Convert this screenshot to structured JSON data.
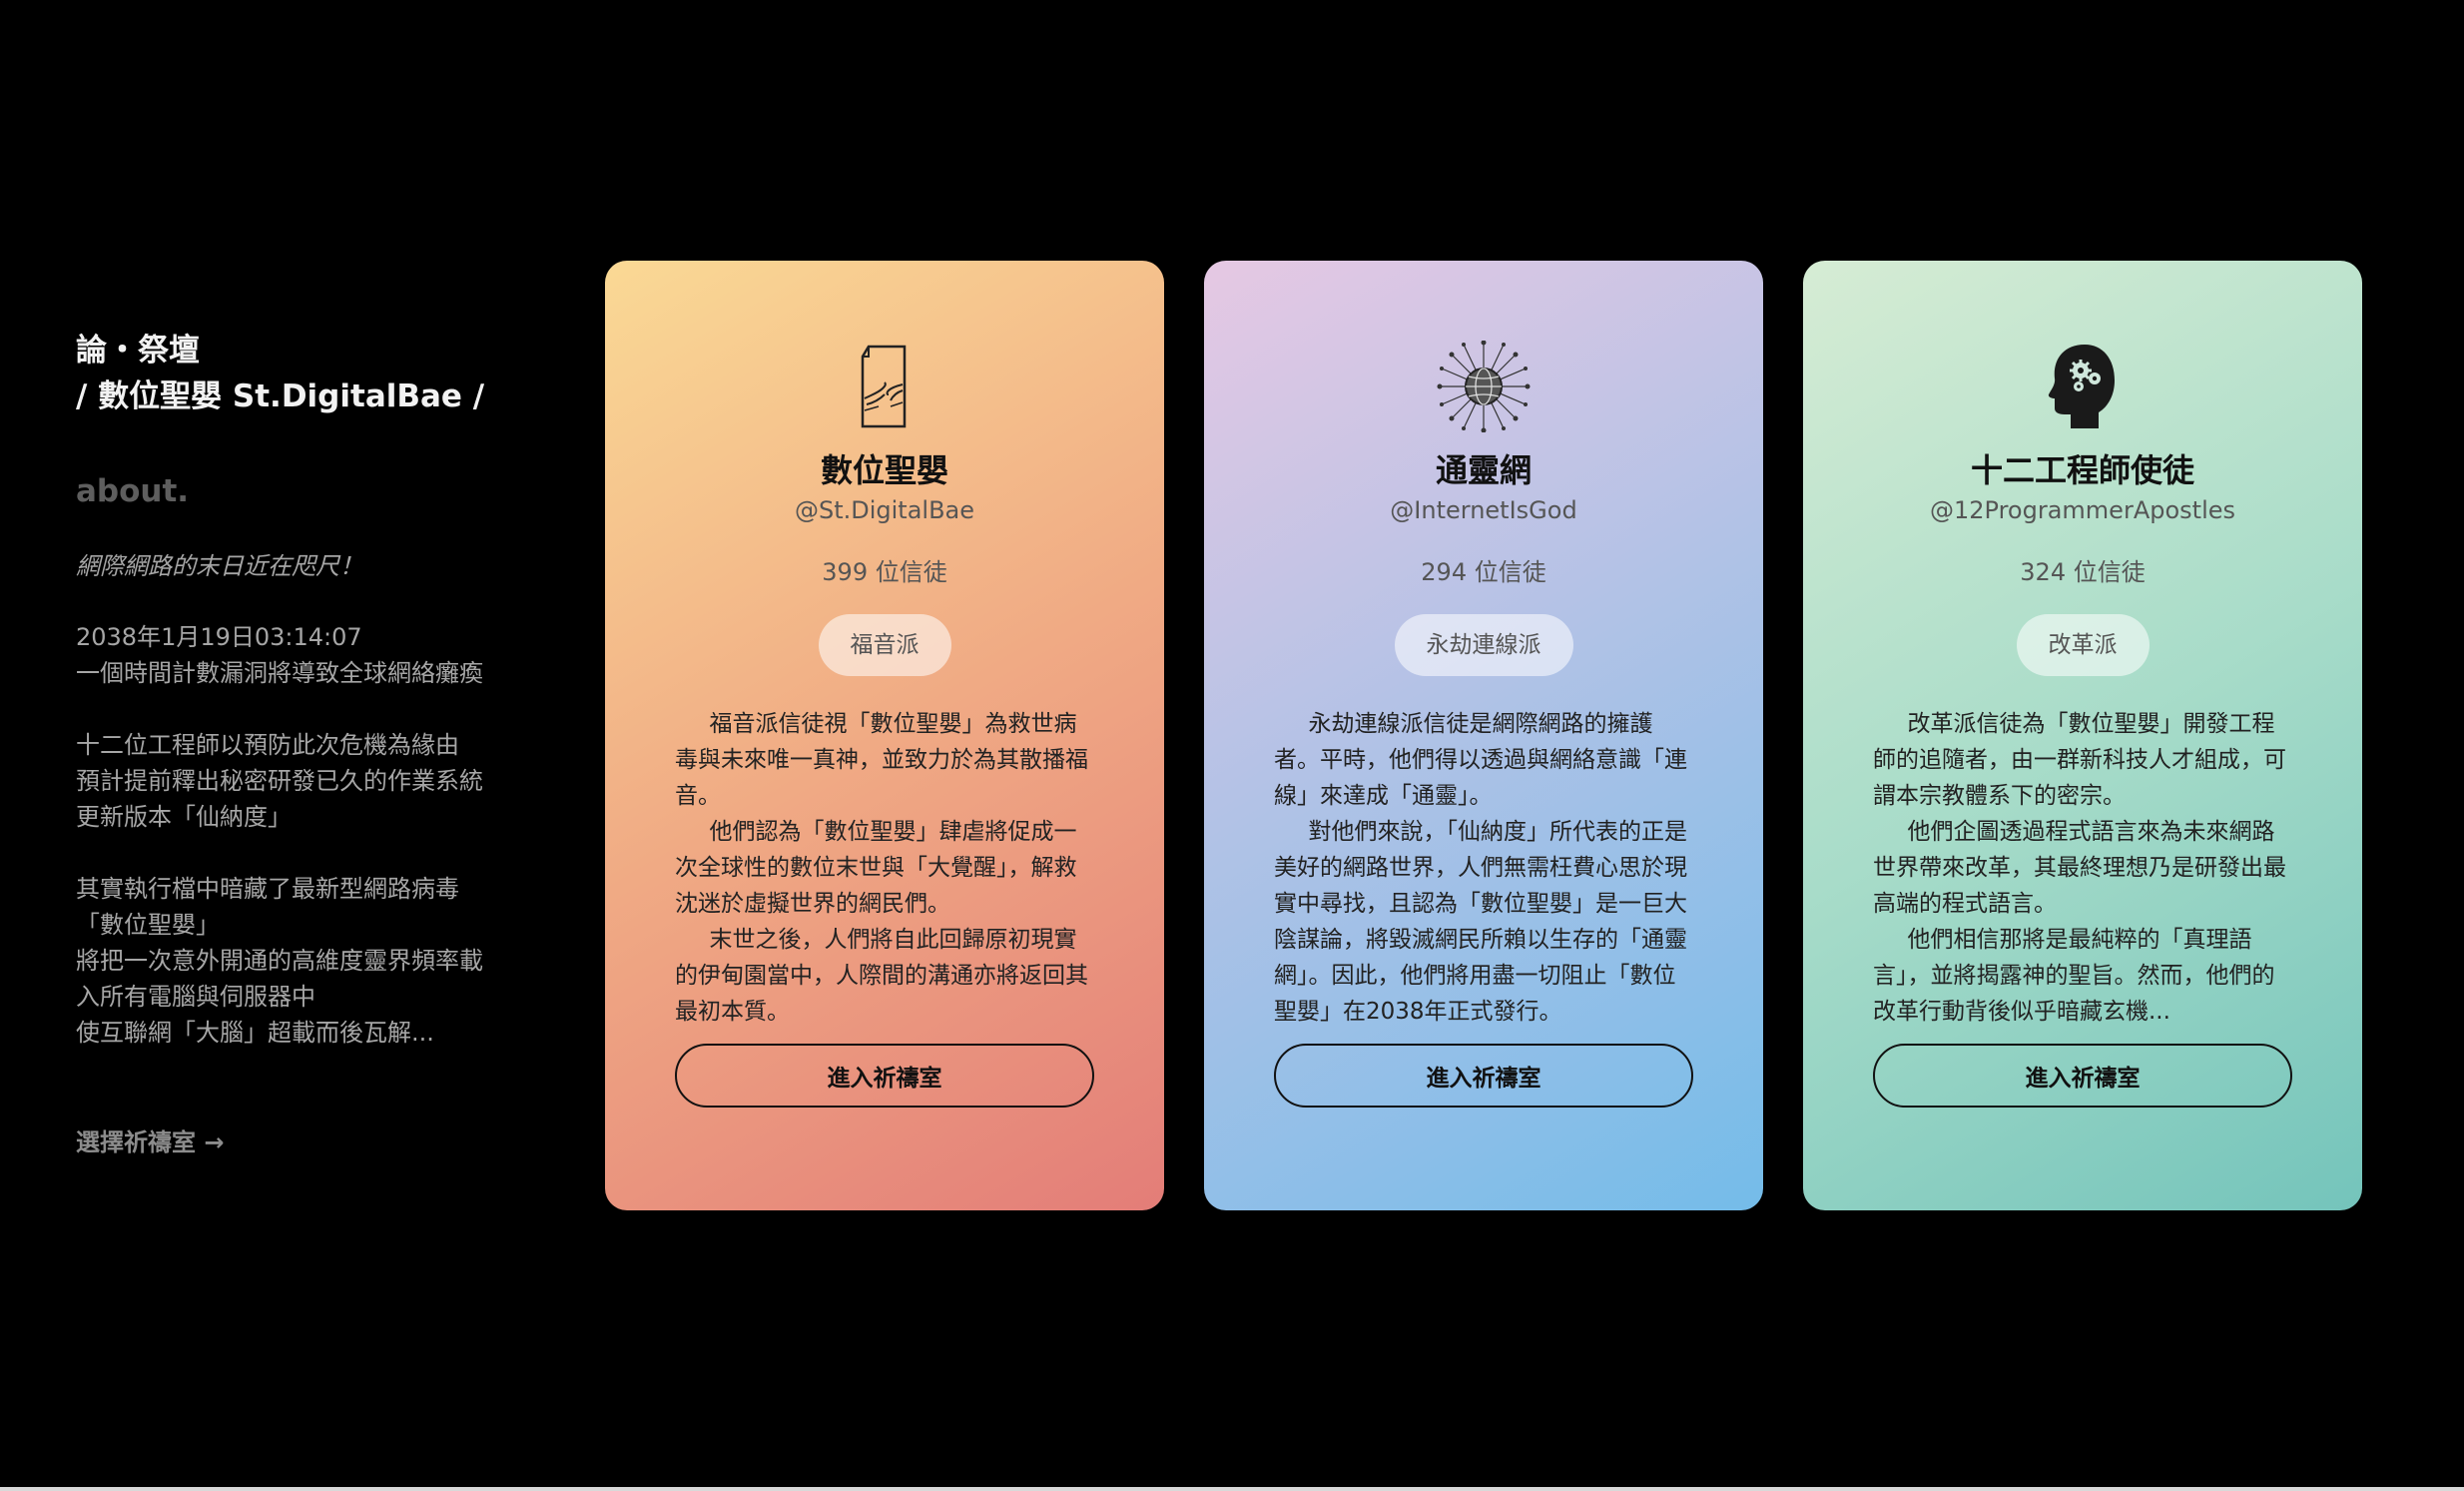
{
  "sidebar": {
    "title_line1": "論・祭壇",
    "title_line2": "/ 數位聖嬰 St.DigitalBae /",
    "about_heading": "about.",
    "tagline": "網際網路的末日近在咫尺！",
    "para1": [
      "2038年1月19日03:14:07",
      "一個時間計數漏洞將導致全球網絡癱瘓"
    ],
    "para2": [
      "十二位工程師以預防此次危機為緣由",
      "預計提前釋出秘密研發已久的作業系統",
      "更新版本「仙納度」"
    ],
    "para3": [
      "其實執行檔中暗藏了最新型網路病毒",
      "「數位聖嬰」",
      "將把一次意外開通的高維度靈界頻率載",
      "入所有電腦與伺服器中",
      "使互聯網「大腦」超載而後瓦解..."
    ],
    "choose_link": "選擇祈禱室 →"
  },
  "cards": [
    {
      "icon": "creation-hands-page-icon",
      "name": "數位聖嬰",
      "handle": "@St.DigitalBae",
      "followers": "399 位信徒",
      "badge": "福音派",
      "paragraphs": [
        "福音派信徒視「數位聖嬰」為救世病毒與未來唯一真神，並致力於為其散播福音。",
        "他們認為「數位聖嬰」肆虐將促成一次全球性的數位末世與「大覺醒」，解救沈迷於虛擬世界的網民們。",
        "末世之後，人們將自此回歸原初現實的伊甸園當中，人際間的溝通亦將返回其最初本質。"
      ],
      "button": "進入祈禱室"
    },
    {
      "icon": "globe-network-icon",
      "name": "通靈網",
      "handle": "@InternetIsGod",
      "followers": "294 位信徒",
      "badge": "永劫連線派",
      "paragraphs": [
        "永劫連線派信徒是網際網路的擁護者。平時，他們得以透過與網絡意識「連線」來達成「通靈」。",
        "對他們來說，「仙納度」所代表的正是美好的網路世界，人們無需枉費心思於現實中尋找，且認為「數位聖嬰」是一巨大陰謀論，將毀滅網民所賴以生存的「通靈網」。因此，他們將用盡一切阻止「數位聖嬰」在2038年正式發行。"
      ],
      "button": "進入祈禱室"
    },
    {
      "icon": "head-gears-icon",
      "name": "十二工程師使徒",
      "handle": "@12ProgrammerApostles",
      "followers": "324 位信徒",
      "badge": "改革派",
      "paragraphs": [
        "改革派信徒為「數位聖嬰」開發工程師的追隨者，由一群新科技人才組成，可謂本宗教體系下的密宗。",
        "他們企圖透過程式語言來為未來網路世界帶來改革，其最終理想乃是研發出最高端的程式語言。",
        "他們相信那將是最純粹的「真理語言」，並將揭露神的聖旨。然而，他們的改革行動背後似乎暗藏玄機..."
      ],
      "button": "進入祈禱室"
    }
  ]
}
